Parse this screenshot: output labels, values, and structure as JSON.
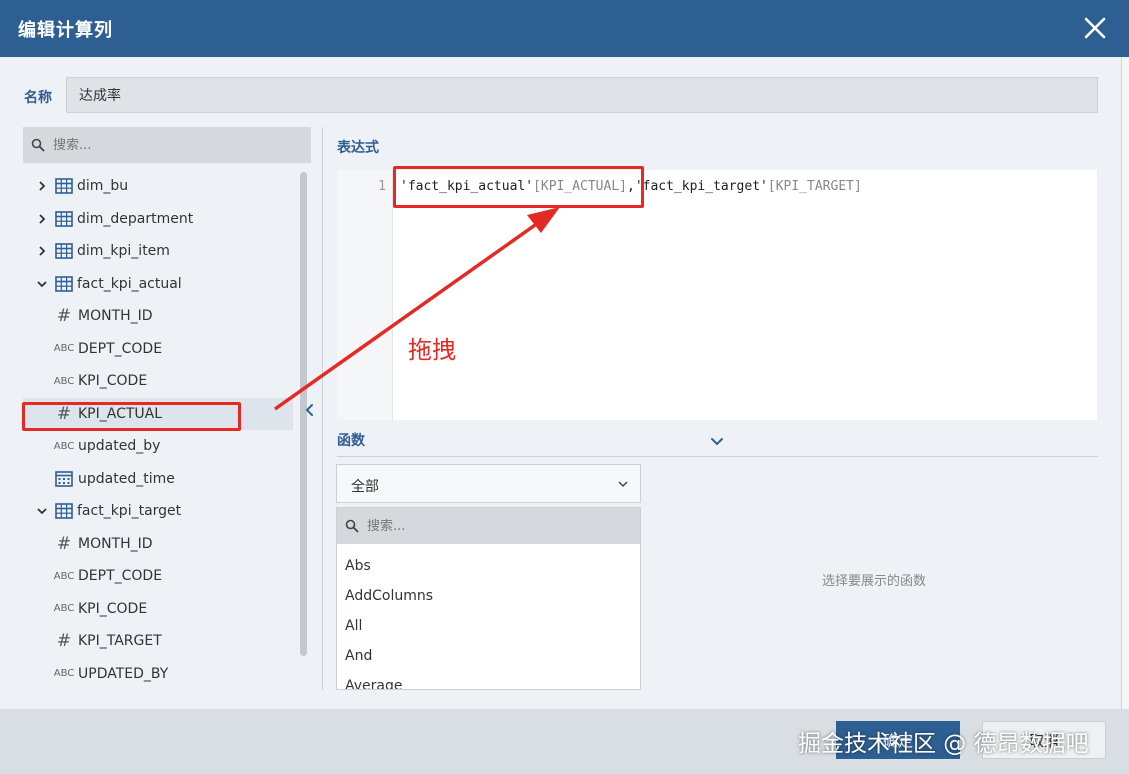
{
  "dialog": {
    "title": "编辑计算列",
    "colors": {
      "header": "#2e5f93",
      "annotation": "#e52a25"
    }
  },
  "name": {
    "label": "名称",
    "value": "达成率"
  },
  "left_panel": {
    "search_placeholder": "搜索...",
    "tree": [
      {
        "type": "table",
        "label": "dim_bu",
        "expanded": false
      },
      {
        "type": "table",
        "label": "dim_department",
        "expanded": false
      },
      {
        "type": "table",
        "label": "dim_kpi_item",
        "expanded": false
      },
      {
        "type": "table",
        "label": "fact_kpi_actual",
        "expanded": true
      },
      {
        "type": "field",
        "kind": "#",
        "label": "MONTH_ID"
      },
      {
        "type": "field",
        "kind": "ABC",
        "label": "DEPT_CODE"
      },
      {
        "type": "field",
        "kind": "ABC",
        "label": "KPI_CODE"
      },
      {
        "type": "field",
        "kind": "#",
        "label": "KPI_ACTUAL",
        "selected": true
      },
      {
        "type": "field",
        "kind": "ABC",
        "label": "updated_by"
      },
      {
        "type": "field",
        "kind": "date",
        "label": "updated_time"
      },
      {
        "type": "table",
        "label": "fact_kpi_target",
        "expanded": true
      },
      {
        "type": "field",
        "kind": "#",
        "label": "MONTH_ID"
      },
      {
        "type": "field",
        "kind": "ABC",
        "label": "DEPT_CODE"
      },
      {
        "type": "field",
        "kind": "ABC",
        "label": "KPI_CODE"
      },
      {
        "type": "field",
        "kind": "#",
        "label": "KPI_TARGET"
      },
      {
        "type": "field",
        "kind": "ABC",
        "label": "UPDATED_BY"
      }
    ]
  },
  "expression": {
    "label": "表达式",
    "line_number": "1",
    "tokens": {
      "t1": "'fact_kpi_actual'",
      "c1": "[KPI_ACTUAL]",
      "sep": ",",
      "t2": "'fact_kpi_target'",
      "c2": "[KPI_TARGET]"
    }
  },
  "annotation": {
    "text": "拖拽"
  },
  "functions": {
    "label": "函数",
    "category": "全部",
    "search_placeholder": "搜索...",
    "items": [
      "Abs",
      "AddColumns",
      "All",
      "And",
      "Average"
    ],
    "empty_hint": "选择要展示的函数"
  },
  "footer": {
    "ok_label": "确定",
    "cancel_label": "取消",
    "watermark": "掘金技术社区 @ 德昂数据吧"
  }
}
